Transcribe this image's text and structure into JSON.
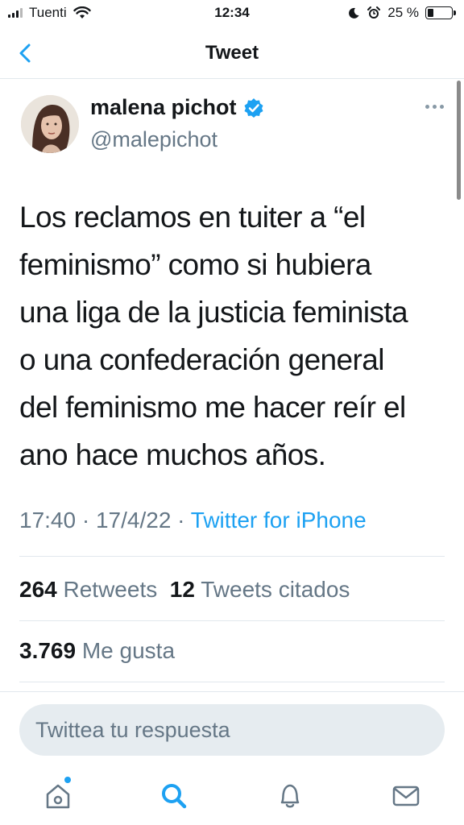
{
  "status_bar": {
    "carrier": "Tuenti",
    "time": "12:34",
    "battery": "25 %",
    "battery_level": 0.25,
    "icons": [
      "signal-icon",
      "wifi-icon",
      "moon-icon",
      "alarm-icon",
      "battery-icon"
    ]
  },
  "nav": {
    "title": "Tweet",
    "back_icon": "chevron-left-icon"
  },
  "tweet": {
    "author_name": "malena pichot",
    "verified": true,
    "handle": "@malepichot",
    "text_lines": [
      "Los reclamos en tuiter a “el",
      "feminismo” como si hubiera",
      "una liga de la justicia feminista",
      "o una confederación general",
      "del feminismo me hacer reír el",
      "ano hace muchos años."
    ],
    "time": "17:40",
    "date": "17/4/22",
    "separator": "·",
    "source": "Twitter for iPhone"
  },
  "stats": {
    "retweets_count": "264",
    "retweets_label": "Retweets",
    "quotes_count": "12",
    "quotes_label": "Tweets citados",
    "likes_count": "3.769",
    "likes_label": "Me gusta"
  },
  "reply": {
    "placeholder": "Twittea tu respuesta"
  },
  "tab_bar": {
    "items": [
      "home-icon",
      "search-icon",
      "notifications-icon",
      "messages-icon"
    ],
    "home_has_notification": true
  },
  "colors": {
    "accent": "#1da1f2",
    "text": "#14171a",
    "secondary": "#657786",
    "divider": "#e1e8ed",
    "reply_bg": "#e6ecf0"
  }
}
